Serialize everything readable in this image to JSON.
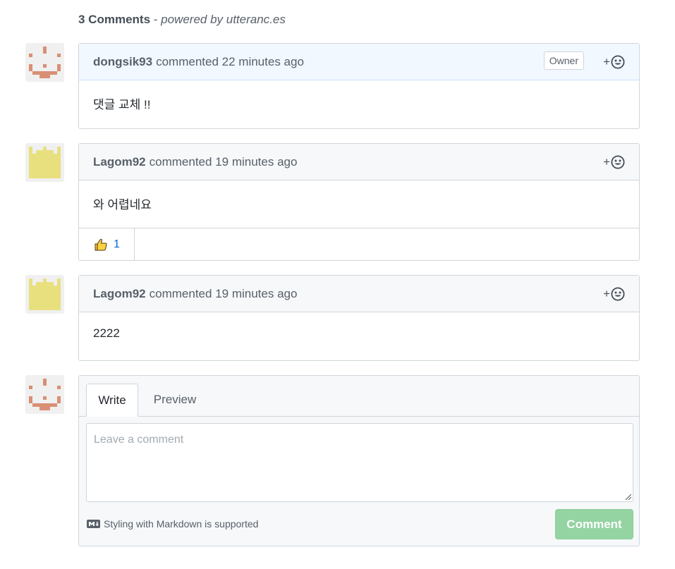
{
  "header": {
    "count_label": "3 Comments",
    "separator": " - ",
    "powered_by": "powered by utteranc.es"
  },
  "comments": [
    {
      "author": "dongsik93",
      "action": "commented",
      "time": "22 minutes ago",
      "badge": "Owner",
      "body": "댓글 교체 !!",
      "avatar_color": "#d98f74",
      "reactions": []
    },
    {
      "author": "Lagom92",
      "action": "commented",
      "time": "19 minutes ago",
      "body": "와 어렵네요",
      "avatar_color": "#e8e07f",
      "reactions": [
        {
          "icon": "thumbs-up-icon",
          "count": "1"
        }
      ]
    },
    {
      "author": "Lagom92",
      "action": "commented",
      "time": "19 minutes ago",
      "body": "2222",
      "avatar_color": "#e8e07f",
      "reactions": []
    }
  ],
  "reaction_button": {
    "plus": "+",
    "icon": "smiley-icon"
  },
  "new_comment": {
    "tabs": [
      "Write",
      "Preview"
    ],
    "active_tab": "Write",
    "placeholder": "Leave a comment",
    "value": "",
    "markdown_hint": "Styling with Markdown is supported",
    "markdown_icon": "markdown-icon",
    "submit_label": "Comment",
    "submit_color": "#94d3a2"
  }
}
